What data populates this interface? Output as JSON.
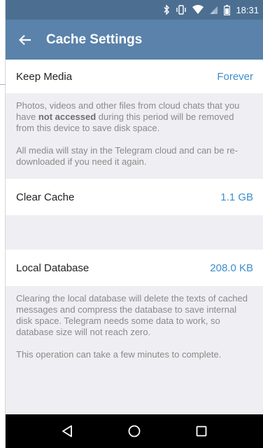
{
  "status_bar": {
    "time": "18:31",
    "icons": [
      "bluetooth-icon",
      "vibrate-icon",
      "wifi-icon",
      "signal-icon",
      "battery-icon"
    ]
  },
  "app_bar": {
    "title": "Cache Settings",
    "back_icon": "arrow-left-icon"
  },
  "keep_media": {
    "label": "Keep Media",
    "value": "Forever"
  },
  "keep_media_info": {
    "line1_before": "Photos, videos and other files from cloud chats that you have ",
    "line1_bold": "not accessed",
    "line1_after": " during this period will be removed from this device to save disk space.",
    "line2": "All media will stay in the Telegram cloud and can be re-downloaded if you need it again."
  },
  "clear_cache": {
    "label": "Clear Cache",
    "value": "1.1 GB"
  },
  "local_database": {
    "label": "Local Database",
    "value": "208.0 KB"
  },
  "local_database_info": {
    "line1": "Clearing the local database will delete the texts of cached messages and compress the database to save internal disk space. Telegram needs some data to work, so database size will not reach zero.",
    "line2": "This operation can take a few minutes to complete."
  },
  "nav_bar": {
    "icons": [
      "back-triangle-icon",
      "home-circle-icon",
      "recents-square-icon"
    ]
  },
  "colors": {
    "status_bar": "#4c6f91",
    "app_bar": "#5a82aa",
    "accent_value": "#3d8ecb",
    "background": "#efeff3"
  }
}
